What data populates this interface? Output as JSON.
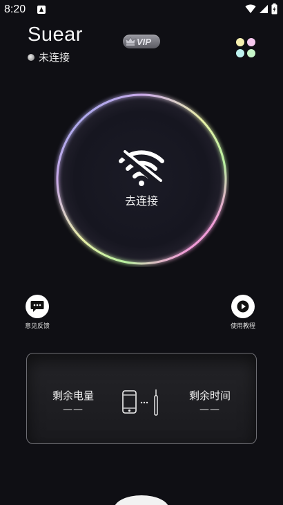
{
  "status_bar": {
    "time": "8:20"
  },
  "header": {
    "app_title": "Suear",
    "connection_status": "未连接",
    "vip_label": "VIP"
  },
  "main": {
    "connect_label": "去连接"
  },
  "actions": {
    "feedback_label": "意见反馈",
    "tutorial_label": "使用教程"
  },
  "stats": {
    "battery_label": "剩余电量",
    "battery_value": "——",
    "time_label": "剩余时间",
    "time_value": "——"
  },
  "colors": {
    "background": "#0f0f14",
    "dot_yellow": "#f6f0b0",
    "dot_pink": "#f5c8ee",
    "dot_cyan": "#bff3f0",
    "dot_green": "#c6f5c9"
  }
}
